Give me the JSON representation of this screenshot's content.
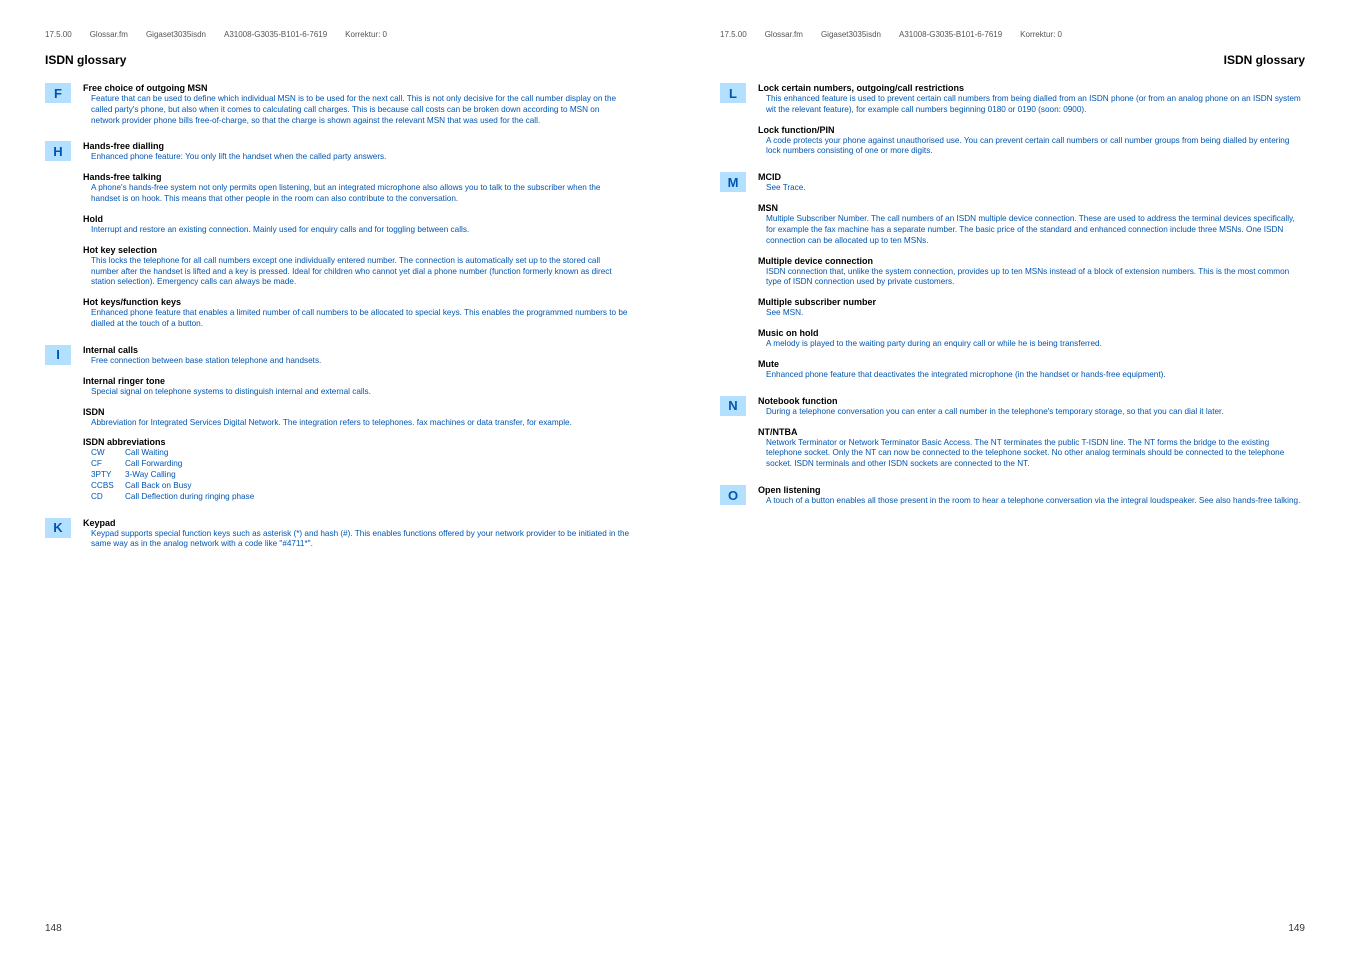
{
  "header": {
    "date": "17.5.00",
    "file": "Glossar.fm",
    "product": "Gigaset3035isdn",
    "code": "A31008-G3035-B101-6-7619",
    "korr": "Korrektur: 0"
  },
  "title_left": "ISDN glossary",
  "title_right": "ISDN glossary",
  "page_left": "148",
  "page_right": "149",
  "left_sections": [
    {
      "letter": "F",
      "entries": [
        {
          "title": "Free choice of outgoing MSN",
          "body": "Feature that can be used to define which individual MSN is to be used for the next call. This is not only decisive for the call number display on the called party's phone, but also when it comes to calculating call charges. This is because call costs can be broken down according to MSN on network provider phone bills free-of-charge, so that the charge is shown against the relevant MSN that was used for the call."
        }
      ]
    },
    {
      "letter": "H",
      "entries": [
        {
          "title": "Hands-free dialling",
          "body": "Enhanced phone feature: You only lift the handset when the called party answers."
        },
        {
          "title": "Hands-free talking",
          "body": "A phone's hands-free system not only permits open listening, but an integrated microphone also allows you to talk to the subscriber when the handset is on hook. This means that other people in the room can also contribute to the conversation."
        },
        {
          "title": "Hold",
          "body": "Interrupt and restore an existing connection. Mainly used for enquiry calls and for toggling between calls."
        },
        {
          "title": "Hot key selection",
          "body": "This locks the telephone for all call numbers except one individually entered number. The connection is automatically set up to the stored call number after the handset is lifted and a key is pressed. Ideal for children who cannot yet dial a phone number (function formerly known as direct station selection). Emergency calls can always be made."
        },
        {
          "title": "Hot keys/function keys",
          "body": "Enhanced phone feature that enables a limited number of call numbers to be allocated to special keys. This enables the programmed numbers to be dialled at the touch of a button."
        }
      ]
    },
    {
      "letter": "I",
      "entries": [
        {
          "title": "Internal calls",
          "body": "Free connection between base station telephone and handsets."
        },
        {
          "title": "Internal ringer tone",
          "body": "Special signal on telephone systems to distinguish internal and external calls."
        },
        {
          "title": "ISDN",
          "body": "Abbreviation for Integrated Services Digital Network. The integration refers to telephones. fax machines or data transfer, for example."
        },
        {
          "title": "ISDN abbreviations",
          "abbrevs": [
            {
              "code": "CW",
              "desc": "Call Waiting"
            },
            {
              "code": "CF",
              "desc": "Call Forwarding"
            },
            {
              "code": "3PTY",
              "desc": "3-Way Calling"
            },
            {
              "code": "CCBS",
              "desc": "Call Back on Busy"
            },
            {
              "code": "CD",
              "desc": "Call Deflection during ringing phase"
            }
          ]
        }
      ]
    },
    {
      "letter": "K",
      "entries": [
        {
          "title": "Keypad",
          "body": "Keypad supports special function keys such as asterisk (*) and hash (#). This enables functions offered by your network provider to be initiated in the same way as in the analog network with a code like \"#4711*\"."
        }
      ]
    }
  ],
  "right_sections": [
    {
      "letter": "L",
      "entries": [
        {
          "title": "Lock certain numbers, outgoing/call restrictions",
          "body": "This enhanced feature is used to prevent certain call numbers from being dialled from an ISDN phone (or from an analog phone on an ISDN system wit the relevant feature), for example call numbers beginning 0180 or 0190 (soon: 0900)."
        },
        {
          "title": "Lock function/PIN",
          "body": "A code protects your phone against unauthorised use. You can prevent certain call numbers or call number groups from being dialled by entering lock numbers consisting of one or more digits."
        }
      ]
    },
    {
      "letter": "M",
      "entries": [
        {
          "title": "MCID",
          "body": "See Trace."
        },
        {
          "title": "MSN",
          "body": "Multiple Subscriber Number. The call numbers of an ISDN multiple device connection. These are used to address the terminal devices specifically, for example the fax machine has a separate number. The basic price of the standard and enhanced connection include three MSNs. One ISDN connection can be allocated up to ten MSNs."
        },
        {
          "title": "Multiple device connection",
          "body": "ISDN connection that, unlike the system connection, provides up to ten MSNs instead of a block of extension numbers. This is the most common type of ISDN connection used by private customers."
        },
        {
          "title": "Multiple subscriber number",
          "body": "See MSN."
        },
        {
          "title": "Music on hold",
          "body": "A melody is played to the waiting party during an enquiry call or while he is being transferred."
        },
        {
          "title": "Mute",
          "body": "Enhanced phone feature that deactivates the integrated microphone (in the handset or hands-free equipment)."
        }
      ]
    },
    {
      "letter": "N",
      "entries": [
        {
          "title": "Notebook function",
          "body": "During a telephone conversation you can enter a call number in the telephone's temporary storage, so that you can dial it later."
        },
        {
          "title": "NT/NTBA",
          "body": "Network Terminator or Network Terminator Basic Access. The NT terminates the public T-ISDN line. The NT forms the bridge to the existing telephone socket. Only the NT can now be connected to the telephone socket. No other analog terminals should be connected to the telephone socket. ISDN terminals and other ISDN sockets are connected to the NT."
        }
      ]
    },
    {
      "letter": "O",
      "entries": [
        {
          "title": "Open listening",
          "body": "A touch of a button enables all those present in the room to hear a telephone conversation via the integral loudspeaker. See also hands-free talking."
        }
      ]
    }
  ]
}
